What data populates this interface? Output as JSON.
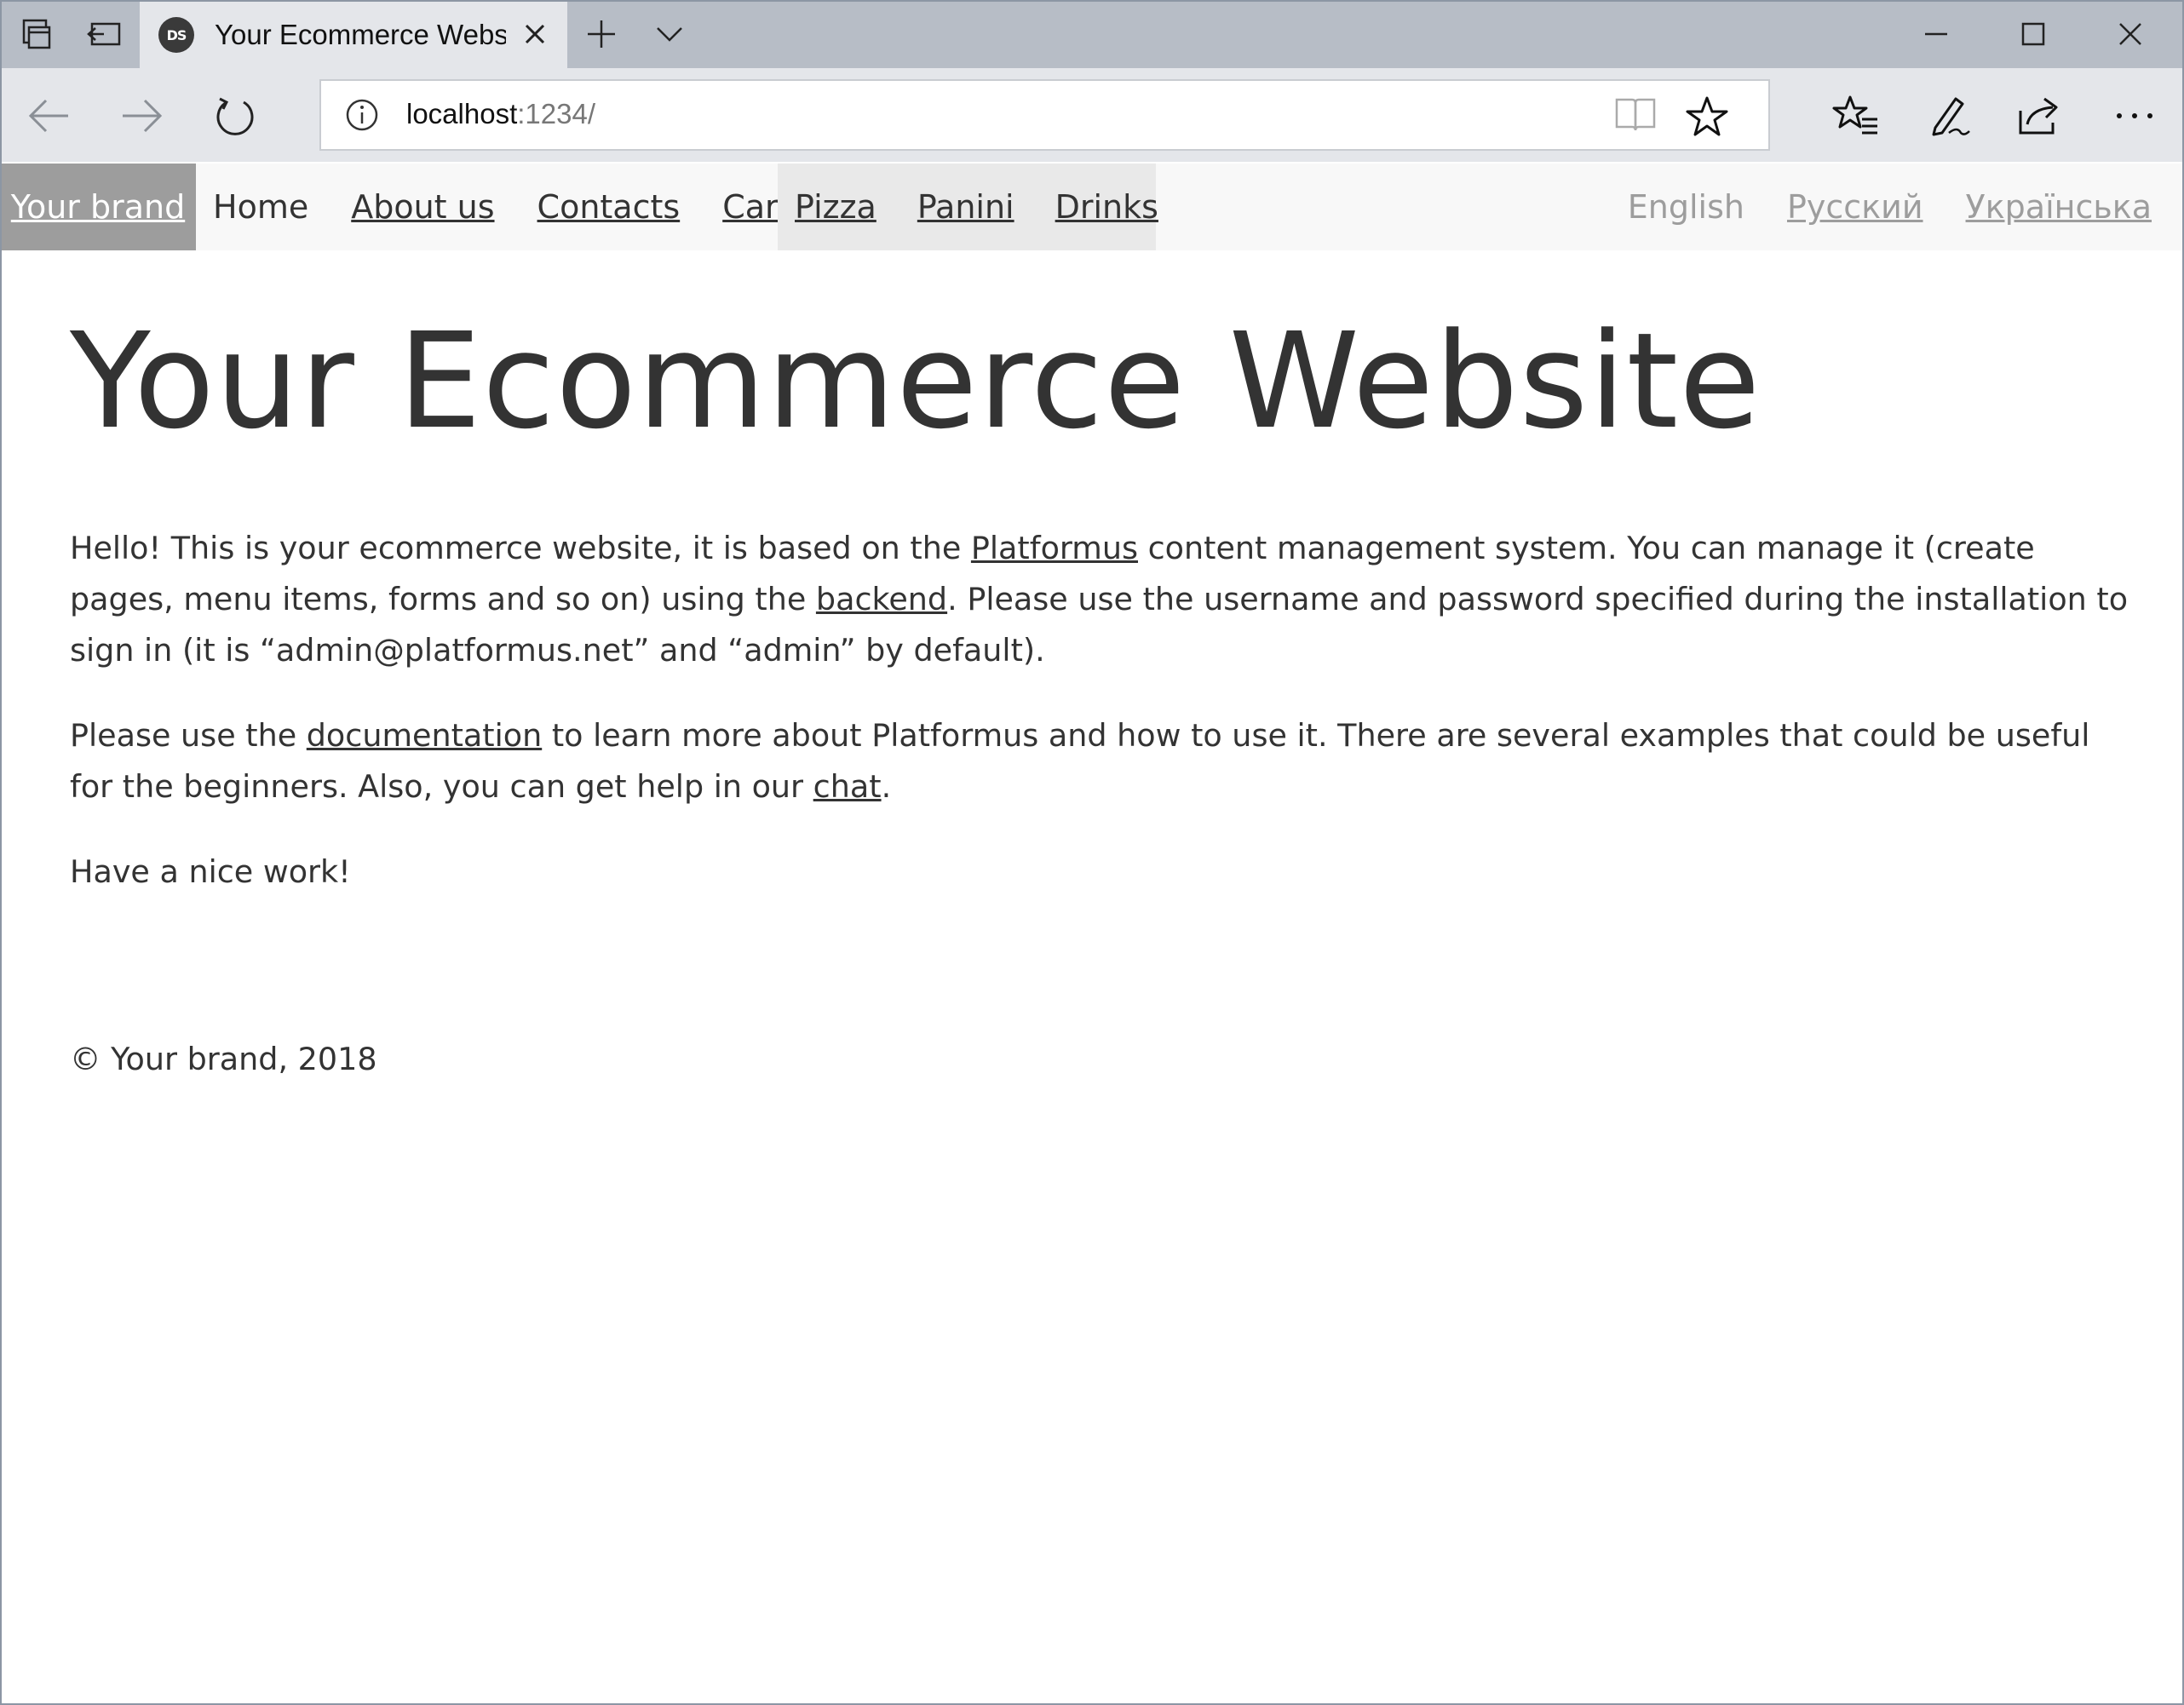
{
  "browser": {
    "tab_title": "Your Ecommerce Websi",
    "favicon_text": "DS",
    "address_host": "localhost",
    "address_port": ":1234/"
  },
  "site": {
    "brand": "Your brand",
    "menu": {
      "home": "Home",
      "about": "About us",
      "contacts": "Contacts",
      "cart": "Cart",
      "pizza": "Pizza",
      "panini": "Panini",
      "drinks": "Drinks"
    },
    "languages": {
      "english": "English",
      "russian": "Русский",
      "ukrainian": "Українська"
    }
  },
  "content": {
    "title": "Your Ecommerce Website",
    "p1_a": "Hello! This is your ecommerce website, it is based on the ",
    "p1_link1": "Platformus",
    "p1_b": " content management system. You can manage it (create pages, menu items, forms and so on) using the ",
    "p1_link2": "backend",
    "p1_c": ". Please use the username and password specified during the installation to sign in (it is “admin@platformus.net” and “admin” by default).",
    "p2_a": "Please use the ",
    "p2_link1": "documentation",
    "p2_b": " to learn more about Platformus and how to use it. There are several examples that could be useful for the beginners. Also, you can get help in our ",
    "p2_link2": "chat",
    "p2_c": ".",
    "p3": "Have a nice work!",
    "footer": "© Your brand, 2018"
  }
}
